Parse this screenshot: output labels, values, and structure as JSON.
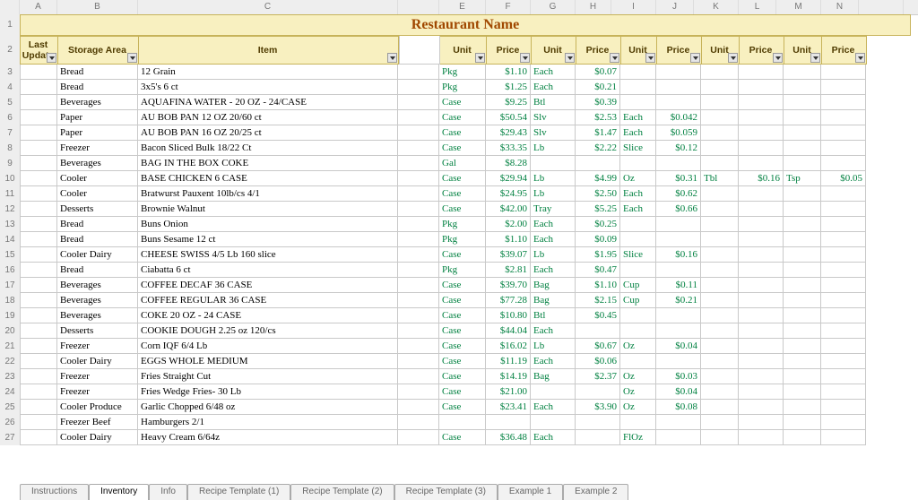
{
  "colLetters": [
    "A",
    "B",
    "C",
    "",
    "E",
    "F",
    "G",
    "H",
    "I",
    "J",
    "K",
    "L",
    "M",
    "N",
    ""
  ],
  "rowNumbers": [
    "1",
    "2",
    "3",
    "4",
    "5",
    "6",
    "7",
    "8",
    "9",
    "10",
    "11",
    "12",
    "13",
    "14",
    "15",
    "16",
    "17",
    "18",
    "19",
    "20",
    "21",
    "22",
    "23",
    "24",
    "25",
    "26",
    "27"
  ],
  "title": "Restaurant Name",
  "headers": {
    "last_update": "Last Update",
    "storage_area": "Storage Area",
    "item": "Item",
    "unit": "Unit",
    "price": "Price"
  },
  "colWidths": {
    "lastupdate": 42,
    "storage": 90,
    "item": 290,
    "gap": 46,
    "unit": 52,
    "price": 50,
    "unit2": 50,
    "price2": 50,
    "unit3": 40,
    "price3": 50,
    "unit4": 42,
    "price4": 50,
    "unit5": 42,
    "price5": 50
  },
  "rows": [
    {
      "storage": "Bread",
      "item": "12 Grain",
      "u1": "Pkg",
      "p1": "$1.10",
      "u2": "Each",
      "p2": "$0.07",
      "u3": "",
      "p3": "",
      "u4": "",
      "p4": "",
      "u5": "",
      "p5": ""
    },
    {
      "storage": "Bread",
      "item": "3x5's   6 ct",
      "u1": "Pkg",
      "p1": "$1.25",
      "u2": "Each",
      "p2": "$0.21",
      "u3": "",
      "p3": "",
      "u4": "",
      "p4": "",
      "u5": "",
      "p5": ""
    },
    {
      "storage": "Beverages",
      "item": "AQUAFINA WATER - 20 OZ - 24/CASE",
      "u1": "Case",
      "p1": "$9.25",
      "u2": "Btl",
      "p2": "$0.39",
      "u3": "",
      "p3": "",
      "u4": "",
      "p4": "",
      "u5": "",
      "p5": ""
    },
    {
      "storage": "Paper",
      "item": "AU BOB PAN 12 OZ  20/60 ct",
      "u1": "Case",
      "p1": "$50.54",
      "u2": "Slv",
      "p2": "$2.53",
      "u3": "Each",
      "p3": "$0.042",
      "u4": "",
      "p4": "",
      "u5": "",
      "p5": ""
    },
    {
      "storage": "Paper",
      "item": "AU BOB PAN 16 OZ  20/25 ct",
      "u1": "Case",
      "p1": "$29.43",
      "u2": "Slv",
      "p2": "$1.47",
      "u3": "Each",
      "p3": "$0.059",
      "u4": "",
      "p4": "",
      "u5": "",
      "p5": ""
    },
    {
      "storage": "Freezer",
      "item": "Bacon Sliced Bulk 18/22 Ct",
      "u1": "Case",
      "p1": "$33.35",
      "u2": "Lb",
      "p2": "$2.22",
      "u3": "Slice",
      "p3": "$0.12",
      "u4": "",
      "p4": "",
      "u5": "",
      "p5": ""
    },
    {
      "storage": "Beverages",
      "item": "BAG IN THE BOX COKE",
      "u1": "Gal",
      "p1": "$8.28",
      "u2": "",
      "p2": "",
      "u3": "",
      "p3": "",
      "u4": "",
      "p4": "",
      "u5": "",
      "p5": ""
    },
    {
      "storage": "Cooler",
      "item": "BASE CHICKEN 6 CASE",
      "u1": "Case",
      "p1": "$29.94",
      "u2": "Lb",
      "p2": "$4.99",
      "u3": "Oz",
      "p3": "$0.31",
      "u4": "Tbl",
      "p4": "$0.16",
      "u5": "Tsp",
      "p5": "$0.05"
    },
    {
      "storage": "Cooler",
      "item": "Bratwurst Pauxent 10lb/cs  4/1",
      "u1": "Case",
      "p1": "$24.95",
      "u2": "Lb",
      "p2": "$2.50",
      "u3": "Each",
      "p3": "$0.62",
      "u4": "",
      "p4": "",
      "u5": "",
      "p5": ""
    },
    {
      "storage": "Desserts",
      "item": "Brownie Walnut",
      "u1": "Case",
      "p1": "$42.00",
      "u2": "Tray",
      "p2": "$5.25",
      "u3": "Each",
      "p3": "$0.66",
      "u4": "",
      "p4": "",
      "u5": "",
      "p5": ""
    },
    {
      "storage": "Bread",
      "item": "Buns Onion",
      "u1": "Pkg",
      "p1": "$2.00",
      "u2": "Each",
      "p2": "$0.25",
      "u3": "",
      "p3": "",
      "u4": "",
      "p4": "",
      "u5": "",
      "p5": ""
    },
    {
      "storage": "Bread",
      "item": "Buns Sesame 12 ct",
      "u1": "Pkg",
      "p1": "$1.10",
      "u2": "Each",
      "p2": "$0.09",
      "u3": "",
      "p3": "",
      "u4": "",
      "p4": "",
      "u5": "",
      "p5": ""
    },
    {
      "storage": "Cooler Dairy",
      "item": "CHEESE SWISS 4/5 Lb  160 slice",
      "u1": "Case",
      "p1": "$39.07",
      "u2": "Lb",
      "p2": "$1.95",
      "u3": "Slice",
      "p3": "$0.16",
      "u4": "",
      "p4": "",
      "u5": "",
      "p5": ""
    },
    {
      "storage": "Bread",
      "item": "Ciabatta 6 ct",
      "u1": "Pkg",
      "p1": "$2.81",
      "u2": "Each",
      "p2": "$0.47",
      "u3": "",
      "p3": "",
      "u4": "",
      "p4": "",
      "u5": "",
      "p5": ""
    },
    {
      "storage": "Beverages",
      "item": "COFFEE DECAF 36 CASE",
      "u1": "Case",
      "p1": "$39.70",
      "u2": "Bag",
      "p2": "$1.10",
      "u3": "Cup",
      "p3": "$0.11",
      "u4": "",
      "p4": "",
      "u5": "",
      "p5": ""
    },
    {
      "storage": "Beverages",
      "item": "COFFEE REGULAR 36 CASE",
      "u1": "Case",
      "p1": "$77.28",
      "u2": "Bag",
      "p2": "$2.15",
      "u3": "Cup",
      "p3": "$0.21",
      "u4": "",
      "p4": "",
      "u5": "",
      "p5": ""
    },
    {
      "storage": "Beverages",
      "item": "COKE 20 OZ - 24 CASE",
      "u1": "Case",
      "p1": "$10.80",
      "u2": "Btl",
      "p2": "$0.45",
      "u3": "",
      "p3": "",
      "u4": "",
      "p4": "",
      "u5": "",
      "p5": ""
    },
    {
      "storage": "Desserts",
      "item": "COOKIE DOUGH  2.25 oz   120/cs",
      "u1": "Case",
      "p1": "$44.04",
      "u2": "Each",
      "p2": "",
      "u3": "",
      "p3": "",
      "u4": "",
      "p4": "",
      "u5": "",
      "p5": ""
    },
    {
      "storage": "Freezer",
      "item": "Corn IQF  6/4 Lb",
      "u1": "Case",
      "p1": "$16.02",
      "u2": "Lb",
      "p2": "$0.67",
      "u3": "Oz",
      "p3": "$0.04",
      "u4": "",
      "p4": "",
      "u5": "",
      "p5": ""
    },
    {
      "storage": "Cooler Dairy",
      "item": "EGGS WHOLE MEDIUM",
      "u1": "Case",
      "p1": "$11.19",
      "u2": "Each",
      "p2": "$0.06",
      "u3": "",
      "p3": "",
      "u4": "",
      "p4": "",
      "u5": "",
      "p5": ""
    },
    {
      "storage": "Freezer",
      "item": "Fries Straight Cut",
      "u1": "Case",
      "p1": "$14.19",
      "u2": "Bag",
      "p2": "$2.37",
      "u3": "Oz",
      "p3": "$0.03",
      "u4": "",
      "p4": "",
      "u5": "",
      "p5": ""
    },
    {
      "storage": "Freezer",
      "item": "Fries Wedge Fries- 30 Lb",
      "u1": "Case",
      "p1": "$21.00",
      "u2": "",
      "p2": "",
      "u3": "Oz",
      "p3": "$0.04",
      "u4": "",
      "p4": "",
      "u5": "",
      "p5": ""
    },
    {
      "storage": "Cooler Produce",
      "item": "Garlic Chopped 6/48 oz",
      "u1": "Case",
      "p1": "$23.41",
      "u2": "Each",
      "p2": "$3.90",
      "u3": "Oz",
      "p3": "$0.08",
      "u4": "",
      "p4": "",
      "u5": "",
      "p5": ""
    },
    {
      "storage": "Freezer Beef",
      "item": "Hamburgers 2/1",
      "u1": "",
      "p1": "",
      "u2": "",
      "p2": "",
      "u3": "",
      "p3": "",
      "u4": "",
      "p4": "",
      "u5": "",
      "p5": ""
    },
    {
      "storage": "Cooler Dairy",
      "item": "Heavy Cream  6/64z",
      "u1": "Case",
      "p1": "$36.48",
      "u2": "Each",
      "p2": "",
      "u3": "FlOz",
      "p3": "",
      "u4": "",
      "p4": "",
      "u5": "",
      "p5": ""
    }
  ],
  "tabs": [
    "Instructions",
    "Inventory",
    "Info",
    "Recipe Template (1)",
    "Recipe Template (2)",
    "Recipe Template (3)",
    "Example 1",
    "Example 2"
  ],
  "activeTab": 1
}
